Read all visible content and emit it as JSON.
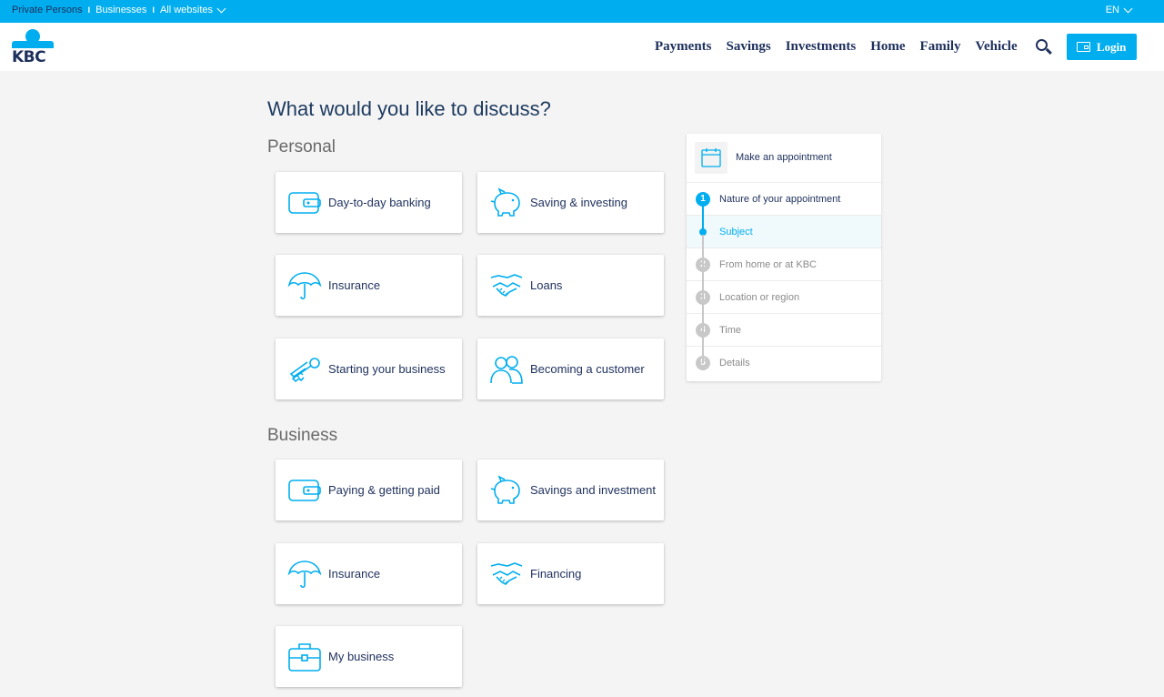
{
  "topbar": {
    "links": [
      "Private Persons",
      "Businesses",
      "All websites"
    ],
    "separator": "I",
    "language": "EN"
  },
  "header": {
    "logo_text": "KBC",
    "nav": [
      "Payments",
      "Savings",
      "Investments",
      "Home",
      "Family",
      "Vehicle"
    ],
    "login_label": "Login"
  },
  "main": {
    "title": "What would you like to discuss?",
    "personal": {
      "title": "Personal",
      "tiles": [
        {
          "label": "Day-to-day banking",
          "icon": "wallet-icon"
        },
        {
          "label": "Saving & investing",
          "icon": "piggy-bank-icon"
        },
        {
          "label": "Insurance",
          "icon": "umbrella-icon"
        },
        {
          "label": "Loans",
          "icon": "handshake-icon"
        },
        {
          "label": "Starting your business",
          "icon": "keys-icon"
        },
        {
          "label": "Becoming a customer",
          "icon": "people-icon"
        }
      ]
    },
    "business": {
      "title": "Business",
      "tiles": [
        {
          "label": "Paying & getting paid",
          "icon": "wallet-icon"
        },
        {
          "label": "Savings and investment",
          "icon": "piggy-bank-icon"
        },
        {
          "label": "Insurance",
          "icon": "umbrella-icon"
        },
        {
          "label": "Financing",
          "icon": "handshake-icon"
        },
        {
          "label": "My business",
          "icon": "briefcase-icon"
        }
      ]
    }
  },
  "sidebar": {
    "title": "Make an appointment",
    "steps": [
      {
        "number": "1",
        "label": "Nature of your appointment"
      },
      {
        "number": "",
        "label": "Subject"
      },
      {
        "number": "2",
        "label": "From home or at KBC"
      },
      {
        "number": "3",
        "label": "Location or region"
      },
      {
        "number": "4",
        "label": "Time"
      },
      {
        "number": "5",
        "label": "Details"
      }
    ]
  },
  "colors": {
    "accent": "#00aeef",
    "navy": "#1d2f5c",
    "background": "#f4f4f4"
  }
}
